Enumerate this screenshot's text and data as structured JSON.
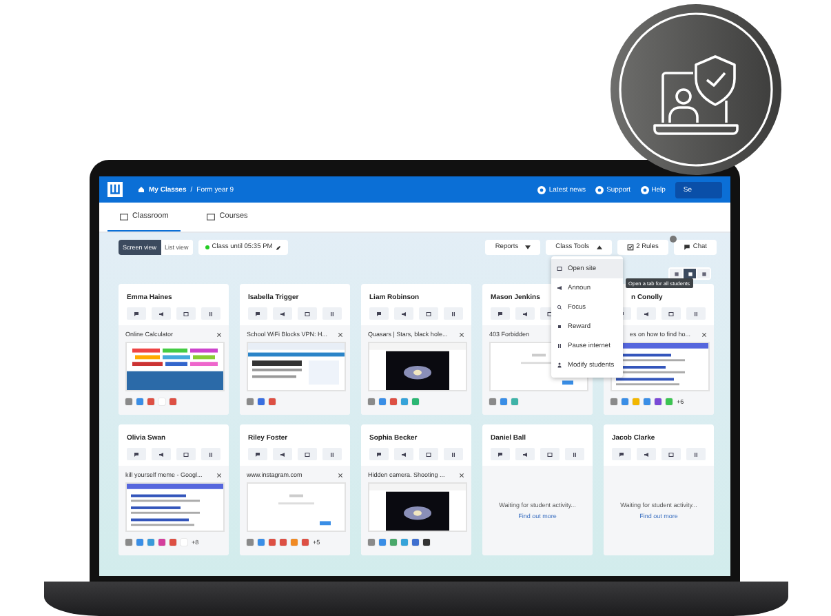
{
  "topbar": {
    "crumbs": [
      "My Classes",
      "Form year 9"
    ],
    "separator": "/",
    "links": [
      "Latest news",
      "Support",
      "Help"
    ],
    "button": "Se"
  },
  "tabs": [
    {
      "label": "Classroom",
      "selected": true
    },
    {
      "label": "Courses",
      "selected": false
    }
  ],
  "views": [
    {
      "label": "Screen view",
      "selected": true
    },
    {
      "label": "List view",
      "selected": false
    }
  ],
  "session": "Class until 05:35 PM",
  "actions": [
    {
      "label": "Reports",
      "kind": "dropdown",
      "expanded": false
    },
    {
      "label": "Class Tools",
      "kind": "dropdown",
      "expanded": true
    },
    {
      "label": "2 Rules",
      "kind": "rules"
    },
    {
      "label": "Chat",
      "kind": "chat",
      "notification": true
    }
  ],
  "menu": {
    "items": [
      {
        "label": "Open site",
        "kind": "open",
        "selected": true
      },
      {
        "label": "Announ",
        "kind": "announce",
        "selected": false
      },
      {
        "label": "Focus",
        "kind": "focus",
        "selected": false
      },
      {
        "label": "Reward",
        "kind": "reward",
        "selected": false
      },
      {
        "label": "Pause internet",
        "kind": "pause",
        "selected": false
      },
      {
        "label": "Modify students",
        "kind": "modify",
        "selected": false
      }
    ],
    "tooltip": "Open a tab for all students"
  },
  "layouts": [
    {
      "selected": false
    },
    {
      "selected": true
    },
    {
      "selected": false
    }
  ],
  "students": [
    {
      "name": "Emma Haines",
      "kind": "active",
      "tab": "Online Calculator",
      "preview": {
        "kind": "calculator"
      },
      "apps": [
        {
          "color": "#8a8a8a"
        },
        {
          "color": "#3a8ee6"
        },
        {
          "color": "#dd5044"
        },
        {
          "color": "#ffffff"
        },
        {
          "color": "#dd5044"
        }
      ]
    },
    {
      "name": "Isabella Trigger",
      "kind": "active",
      "tab": "School WiFi Blocks VPN: H...",
      "preview": {
        "kind": "article"
      },
      "apps": [
        {
          "color": "#8a8a8a"
        },
        {
          "color": "#3a6fe0"
        },
        {
          "color": "#dd5044"
        }
      ]
    },
    {
      "name": "Liam Robinson",
      "kind": "active",
      "tab": "Quasars | Stars, black hole...",
      "preview": {
        "kind": "video"
      },
      "apps": [
        {
          "color": "#8a8a8a"
        },
        {
          "color": "#3a8ee6"
        },
        {
          "color": "#dd5044"
        },
        {
          "color": "#36a3d9"
        },
        {
          "color": "#2bb673"
        }
      ]
    },
    {
      "name": "Mason Jenkins",
      "kind": "active",
      "tab": "403 Forbidden",
      "preview": {
        "kind": "blank"
      },
      "apps": [
        {
          "color": "#8a8a8a"
        },
        {
          "color": "#3a8ee6"
        },
        {
          "color": "#3fb3a8"
        }
      ]
    },
    {
      "name": "n Conolly",
      "kind": "active",
      "tab": "es on how to find ho...",
      "preview": {
        "kind": "results"
      },
      "apps": [
        {
          "color": "#8a8a8a"
        },
        {
          "color": "#3a8ee6"
        },
        {
          "color": "#f2b600"
        },
        {
          "color": "#3a8ee6"
        },
        {
          "color": "#7b4ad6"
        },
        {
          "color": "#3cc452"
        }
      ],
      "more": "+6"
    },
    {
      "name": "Olivia Swan",
      "kind": "active",
      "tab": "kill yourself meme - Googl...",
      "preview": {
        "kind": "results"
      },
      "apps": [
        {
          "color": "#8a8a8a"
        },
        {
          "color": "#3a8ee6"
        },
        {
          "color": "#3a9ad9"
        },
        {
          "color": "#d43f9c"
        },
        {
          "color": "#dd5044"
        },
        {
          "color": "#ffffff"
        }
      ],
      "more": "+8"
    },
    {
      "name": "Riley Foster",
      "kind": "active",
      "tab": "www.instagram.com",
      "preview": {
        "kind": "blank"
      },
      "apps": [
        {
          "color": "#8a8a8a"
        },
        {
          "color": "#3a8ee6"
        },
        {
          "color": "#dd5044"
        },
        {
          "color": "#dd5044"
        },
        {
          "color": "#f08a24"
        },
        {
          "color": "#dd5044"
        }
      ],
      "more": "+5"
    },
    {
      "name": "Sophia Becker",
      "kind": "active",
      "tab": "Hidden camera. Shooting ...",
      "preview": {
        "kind": "video"
      },
      "apps": [
        {
          "color": "#8a8a8a"
        },
        {
          "color": "#3a8ee6"
        },
        {
          "color": "#4aa86b"
        },
        {
          "color": "#36a3d9"
        },
        {
          "color": "#3f6fcf"
        },
        {
          "color": "#333333"
        }
      ]
    },
    {
      "name": "Daniel Ball",
      "kind": "waiting",
      "message": "Waiting for student activity...",
      "link": "Find out more"
    },
    {
      "name": "Jacob Clarke",
      "kind": "waiting",
      "message": "Waiting for student activity...",
      "link": "Find out more"
    }
  ]
}
